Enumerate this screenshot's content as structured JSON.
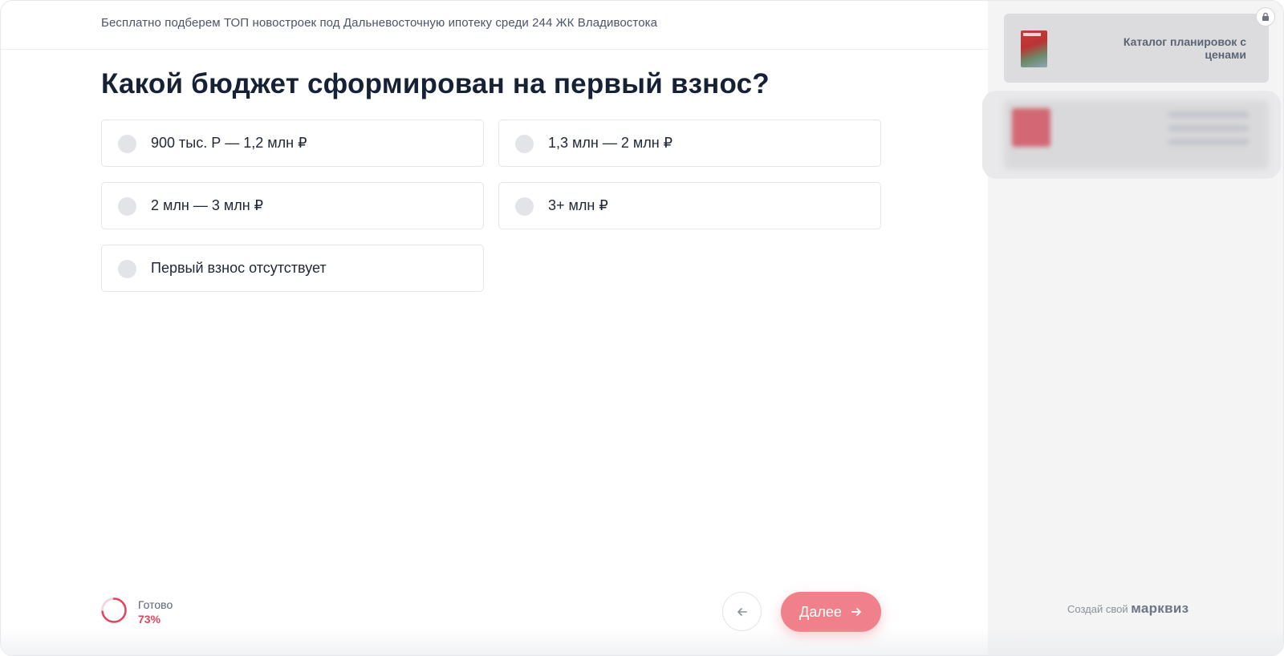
{
  "header": {
    "tagline": "Бесплатно подберем ТОП новостроек под Дальневосточную ипотеку среди 244 ЖК Владивостока"
  },
  "question": {
    "title": "Какой бюджет сформирован на первый взнос?"
  },
  "options": [
    {
      "label": "900 тыс. Р — 1,2 млн ₽"
    },
    {
      "label": "1,3 млн — 2 млн ₽"
    },
    {
      "label": "2 млн — 3 млн ₽"
    },
    {
      "label": "3+ млн ₽"
    },
    {
      "label": "Первый взнос отсутствует"
    }
  ],
  "progress": {
    "title": "Готово",
    "value_label": "73%",
    "fraction": 0.73
  },
  "nav": {
    "next_label": "Далее",
    "back_icon": "arrow-left-icon",
    "next_icon": "arrow-right-icon"
  },
  "sidebar": {
    "catalog_text": "Каталог планировок с ценами",
    "brand_prefix": "Создай свой",
    "brand_name": "марквиз"
  },
  "colors": {
    "accent": "#f08089",
    "progress": "#e0465b",
    "title": "#172136"
  }
}
